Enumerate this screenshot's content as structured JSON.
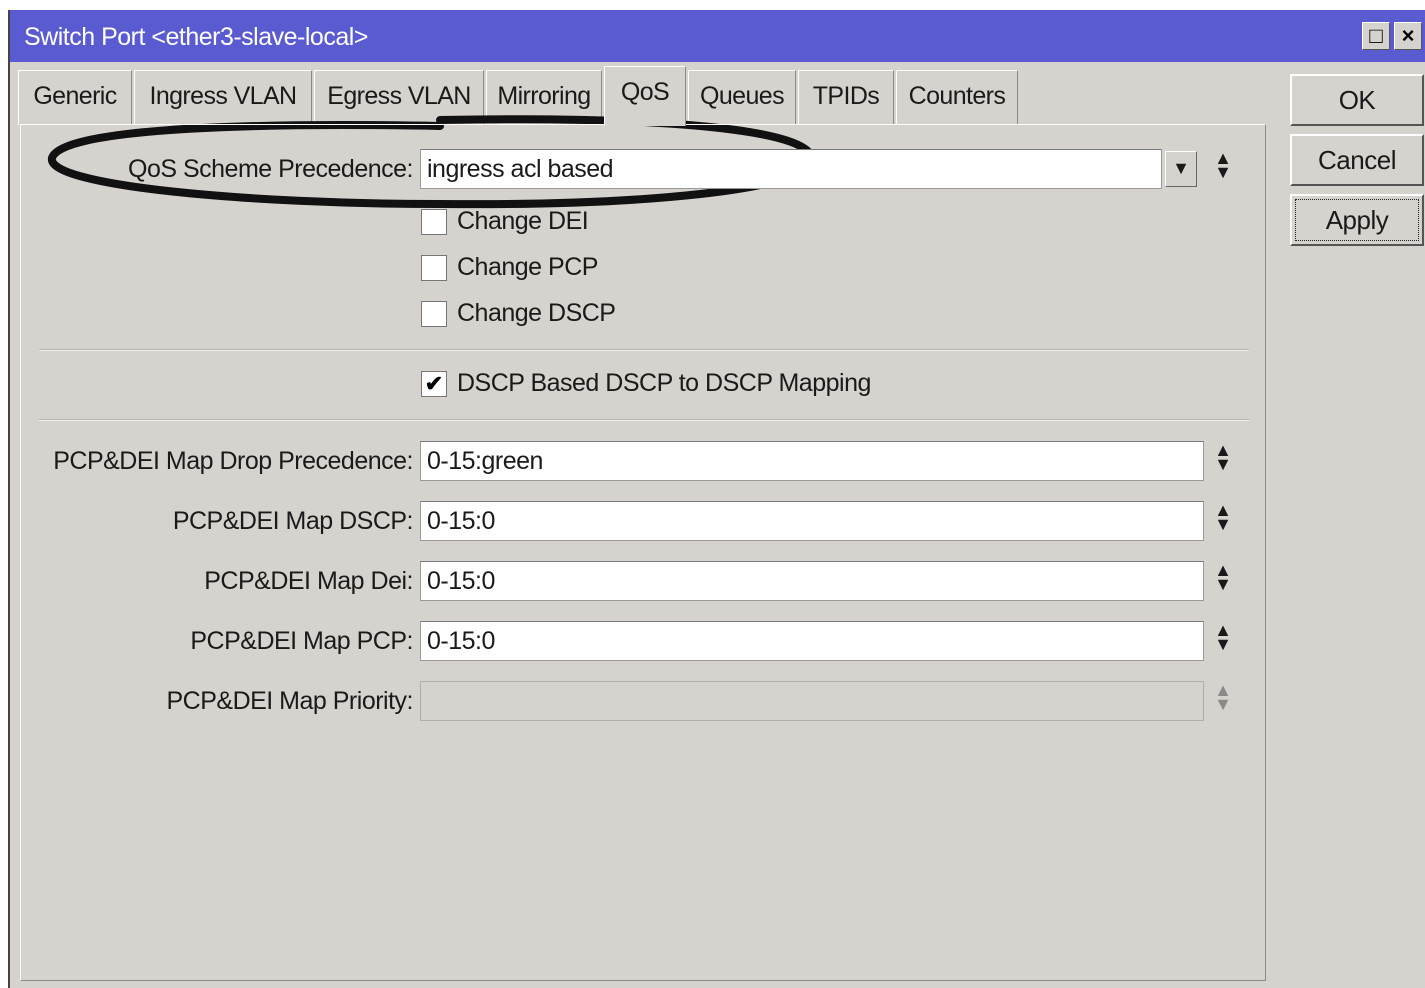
{
  "window": {
    "title": "Switch Port <ether3-slave-local>",
    "titlebar_color": "#5a5bd1",
    "restore_glyph": "□",
    "close_glyph": "×"
  },
  "tabs": [
    {
      "label": "Generic"
    },
    {
      "label": "Ingress VLAN"
    },
    {
      "label": "Egress VLAN"
    },
    {
      "label": "Mirroring"
    },
    {
      "label": "QoS",
      "active": true
    },
    {
      "label": "Queues"
    },
    {
      "label": "TPIDs"
    },
    {
      "label": "Counters"
    }
  ],
  "qos": {
    "scheme_label": "QoS Scheme Precedence:",
    "scheme_value": "ingress acl based",
    "change_dei_label": "Change DEI",
    "change_dei_checked": false,
    "change_pcp_label": "Change PCP",
    "change_pcp_checked": false,
    "change_dscp_label": "Change DSCP",
    "change_dscp_checked": false,
    "dscp_map_label": "DSCP Based DSCP to DSCP Mapping",
    "dscp_map_checked": true,
    "check_glyph": "✔",
    "drop_label": "PCP&DEI Map Drop Precedence:",
    "drop_value": "0-15:green",
    "dscp_label": "PCP&DEI Map DSCP:",
    "dscp_value": "0-15:0",
    "dei_label": "PCP&DEI Map Dei:",
    "dei_value": "0-15:0",
    "pcp_label": "PCP&DEI Map PCP:",
    "pcp_value": "0-15:0",
    "priority_label": "PCP&DEI Map Priority:",
    "priority_value": ""
  },
  "buttons": {
    "ok": "OK",
    "cancel": "Cancel",
    "apply": "Apply"
  },
  "icons": {
    "spin_up": "▲",
    "spin_down": "▼",
    "dropdown": "▼"
  },
  "annotation_color": "#111111"
}
